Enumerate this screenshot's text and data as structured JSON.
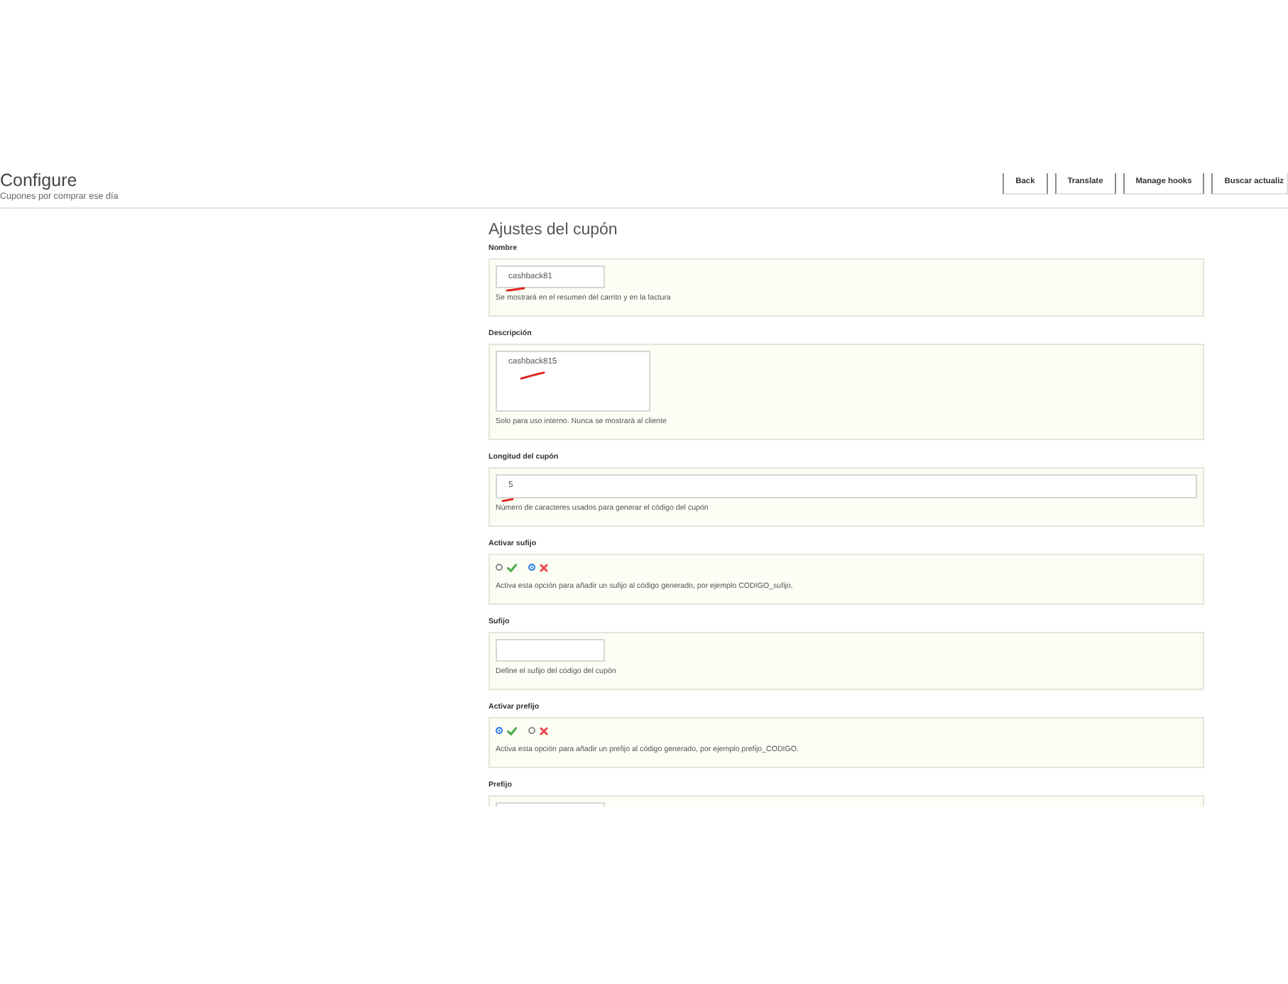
{
  "header": {
    "title": "Configure",
    "subtitle": "Cupones por comprar ese día",
    "buttons": [
      "Back",
      "Translate",
      "Manage hooks",
      "Buscar actualiz"
    ]
  },
  "form": {
    "title": "Ajustes del cupón",
    "fields": [
      {
        "kind": "short-text",
        "label": "Nombre",
        "value": "cashback81",
        "underlined": true,
        "help": "Se mostrará en el resumen del carrito y en la factura"
      },
      {
        "kind": "textarea",
        "label": "Descripción",
        "value": "cashback815",
        "underlined": true,
        "help": "Solo para uso interno. Nunca se mostrará al cliente"
      },
      {
        "kind": "wide-text",
        "label": "Longitud del cupón",
        "value": "5",
        "underlined": true,
        "help": "Número de caracteres usados para generar el código del cupón"
      },
      {
        "kind": "toggle",
        "label": "Activar sufijo",
        "options": [
          {
            "kind": "yes",
            "selected": false
          },
          {
            "kind": "no",
            "selected": true
          }
        ],
        "help": "Activa esta opción para añadir un sufijo al código generado, por ejemplo CODIGO_sufijo."
      },
      {
        "kind": "short-text",
        "label": "Sufijo",
        "underlined": false,
        "help": "Define el sufijo del código del cupón"
      },
      {
        "kind": "toggle",
        "label": "Activar prefijo",
        "options": [
          {
            "kind": "yes",
            "selected": true
          },
          {
            "kind": "no",
            "selected": false
          }
        ],
        "help": "Activa esta opción para añadir un prefijo al código generado, por ejemplo prefijo_CODIGO."
      },
      {
        "kind": "short-text",
        "label": "Prefijo",
        "underlined": false
      }
    ]
  }
}
